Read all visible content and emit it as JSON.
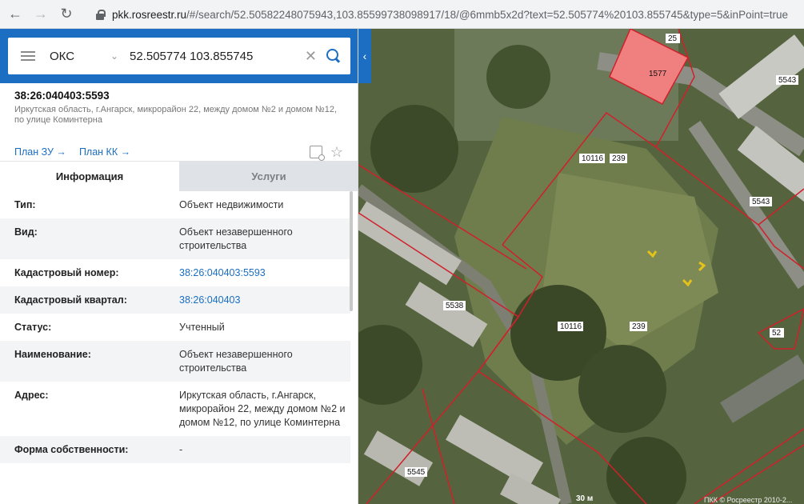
{
  "browser": {
    "back_icon": "arrow-left-icon",
    "forward_icon": "arrow-right-icon",
    "reload_icon": "reload-icon",
    "url_domain": "pkk.rosreestr.ru",
    "url_rest": "/#/search/52.50582248075943,103.85599738098917/18/@6mmb5x2d?text=52.505774%20103.855745&type=5&inPoint=true"
  },
  "search": {
    "type_value": "ОКС",
    "query": "52.505774 103.855745"
  },
  "object": {
    "cadastral_number": "38:26:040403:5593",
    "address": "Иркутская область, г.Ангарск, микрорайон 22, между домом №2 и домом №12, по улице Коминтерна"
  },
  "links": {
    "plan_zu": "План ЗУ →",
    "plan_kk": "План КК →"
  },
  "tabs": [
    {
      "label": "Информация"
    },
    {
      "label": "Услуги"
    }
  ],
  "info_rows": [
    {
      "key": "Тип:",
      "value": "Объект недвижимости"
    },
    {
      "key": "Вид:",
      "value": "Объект незавершенного строительства"
    },
    {
      "key": "Кадастровый номер:",
      "value": "38:26:040403:5593"
    },
    {
      "key": "Кадастровый квартал:",
      "value": "38:26:040403"
    },
    {
      "key": "Статус:",
      "value": "Учтенный"
    },
    {
      "key": "Наименование:",
      "value": "Объект незавершенного строительства"
    },
    {
      "key": "Адрес:",
      "value": "Иркутская область, г.Ангарск, микрорайон 22, между домом №2 и домом №12, по улице Коминтерна"
    },
    {
      "key": "Форма собственности:",
      "value": "-"
    }
  ],
  "map": {
    "parcel_labels": [
      "25",
      "1577",
      "5543",
      "10116",
      "239",
      "5543",
      "5538",
      "10116",
      "239",
      "52",
      "5545"
    ],
    "scale": "30 м",
    "copyright": "ПКК © Росреестр 2010-2..."
  },
  "colors": {
    "brand_blue": "#1b6ec2",
    "parcel_border": "#d0202a",
    "selected_parcel": "#f08080"
  }
}
